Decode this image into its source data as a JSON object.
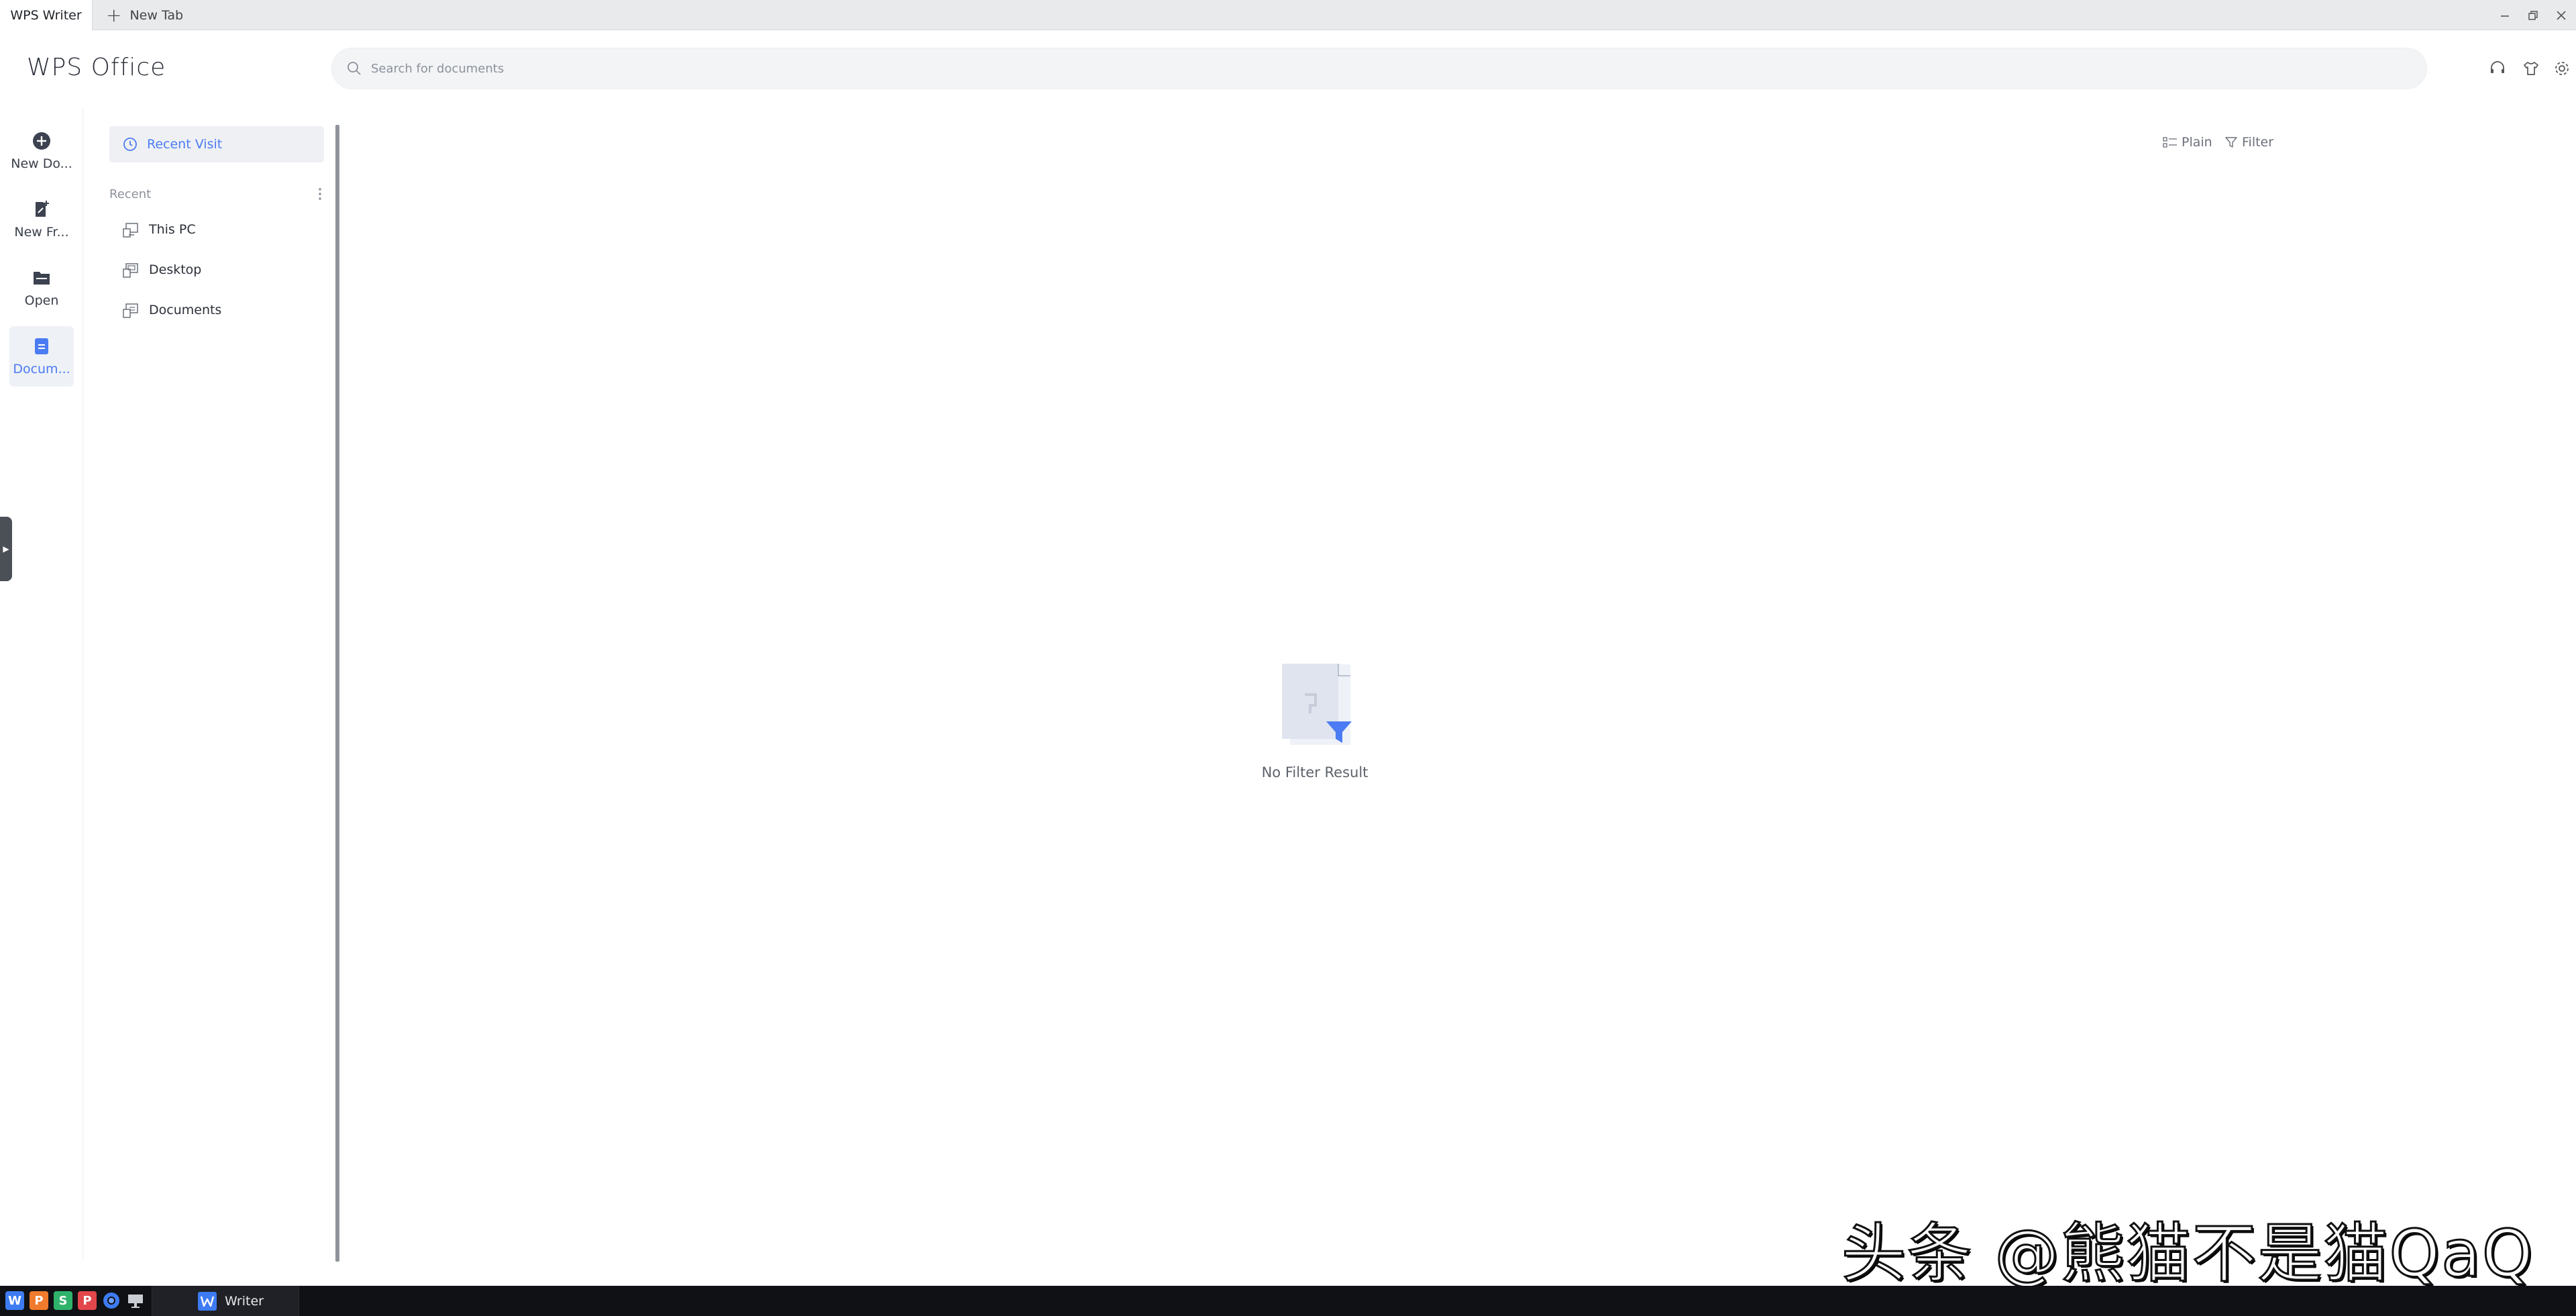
{
  "tabs": {
    "active": "WPS Writer",
    "new_tab": "New Tab"
  },
  "header": {
    "logo": "WPS Office",
    "search_placeholder": "Search for documents"
  },
  "rail": {
    "items": [
      {
        "label": "New Do...",
        "icon": "plus-circle-icon"
      },
      {
        "label": "New Fr...",
        "icon": "new-from-template-icon"
      },
      {
        "label": "Open",
        "icon": "folder-icon"
      },
      {
        "label": "Docum...",
        "icon": "document-icon",
        "active": true
      }
    ]
  },
  "nav": {
    "recent_visit": "Recent Visit",
    "recent_heading": "Recent",
    "locations": [
      "This PC",
      "Desktop",
      "Documents"
    ]
  },
  "main": {
    "view_plain": "Plain",
    "filter": "Filter",
    "empty_text": "No Filter Result"
  },
  "watermark": "头条 @熊猫不是猫QaQ",
  "taskbar": {
    "app_label": "Writer",
    "launchers": [
      {
        "letter": "W",
        "color": "#3d7bf2"
      },
      {
        "letter": "P",
        "color": "#f07b2d"
      },
      {
        "letter": "S",
        "color": "#2fb36b"
      },
      {
        "letter": "P",
        "color": "#e2474b"
      }
    ]
  },
  "colors": {
    "accent": "#4c7cf3",
    "taskbar": "#101114"
  }
}
